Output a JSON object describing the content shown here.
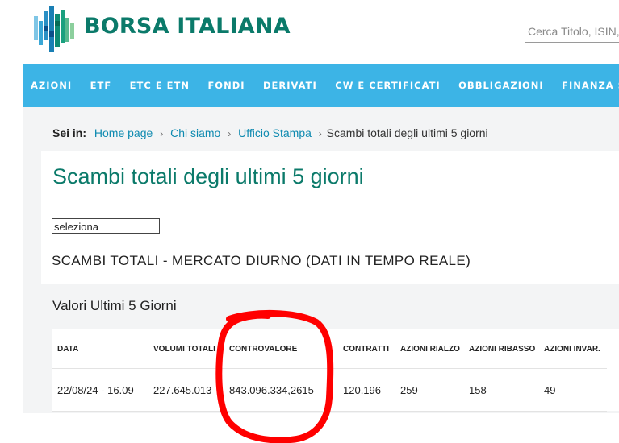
{
  "header": {
    "brand": "BORSA ITALIANA",
    "search_placeholder": "Cerca Titolo, ISIN,",
    "colors": {
      "brand": "#0b7a6a",
      "nav": "#3cb4e6"
    }
  },
  "nav": {
    "items": [
      {
        "label": "AZIONI"
      },
      {
        "label": "ETF"
      },
      {
        "label": "ETC E ETN"
      },
      {
        "label": "FONDI"
      },
      {
        "label": "DERIVATI"
      },
      {
        "label": "CW E CERTIFICATI"
      },
      {
        "label": "OBBLIGAZIONI"
      },
      {
        "label": "FINANZA SOSTENIBILE"
      }
    ]
  },
  "breadcrumb": {
    "label": "Sei in:",
    "links": [
      "Home page",
      "Chi siamo",
      "Ufficio Stampa"
    ],
    "current": "Scambi totali degli ultimi 5 giorni"
  },
  "page": {
    "title": "Scambi totali degli ultimi 5 giorni",
    "select_value": "seleziona",
    "section_heading": "SCAMBI TOTALI - MERCATO DIURNO (DATI IN TEMPO REALE)",
    "values_heading": "Valori Ultimi 5 Giorni"
  },
  "table": {
    "headers": [
      "DATA",
      "VOLUMI TOTALI",
      "CONTROVALORE",
      "CONTRATTI",
      "AZIONI RIALZO",
      "AZIONI RIBASSO",
      "AZIONI INVAR."
    ],
    "rows": [
      [
        "22/08/24 - 16.09",
        "227.645.013",
        "843.096.334,2615",
        "120.196",
        "259",
        "158",
        "49"
      ]
    ]
  },
  "annotation": {
    "color": "#ff0000",
    "highlighted_column": "CONTROVALORE"
  }
}
